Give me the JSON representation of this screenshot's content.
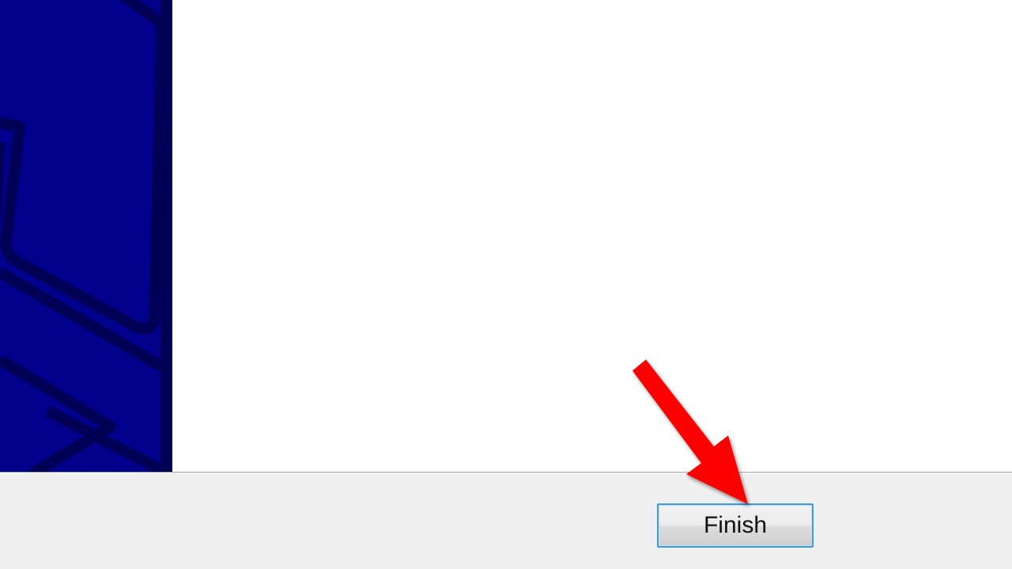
{
  "wizard": {
    "finish_label": "Finish"
  },
  "colors": {
    "banner": "#00008b",
    "banner_pattern": "#000055",
    "content_background": "#ffffff",
    "button_bar": "#f0f0f0",
    "button_focus_border": "#3c9ae6",
    "annotation_arrow": "#ff0000"
  },
  "icons": {
    "annotation": "red-arrow-icon"
  }
}
